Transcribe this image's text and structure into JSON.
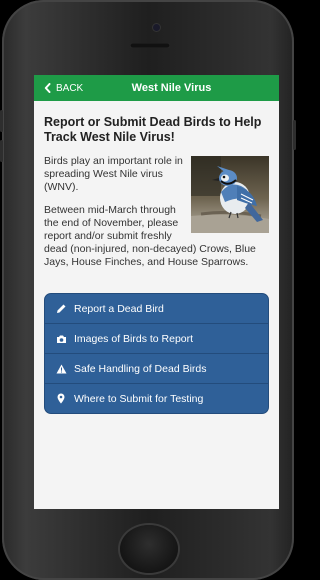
{
  "header": {
    "back_label": "BACK",
    "title": "West Nile Virus"
  },
  "content": {
    "heading": "Report or Submit Dead Birds to Help Track West Nile Virus!",
    "paragraph1": "Birds play an important role in spreading West Nile virus (WNV).",
    "paragraph2": "Between mid-March through the end of November, please report and/or submit freshly dead (non-injured, non-decayed) Crows, Blue Jays, House Finches, and House Sparrows.",
    "image": "blue-jay-photo"
  },
  "menu": {
    "items": [
      {
        "label": "Report a Dead Bird",
        "icon": "pencil-icon"
      },
      {
        "label": "Images of Birds to Report",
        "icon": "camera-icon"
      },
      {
        "label": "Safe Handling of Dead Birds",
        "icon": "warning-icon"
      },
      {
        "label": "Where to Submit for Testing",
        "icon": "map-pin-icon"
      }
    ]
  },
  "colors": {
    "header": "#1e9b47",
    "menu": "#2f6098",
    "background": "#f4f4f4"
  }
}
